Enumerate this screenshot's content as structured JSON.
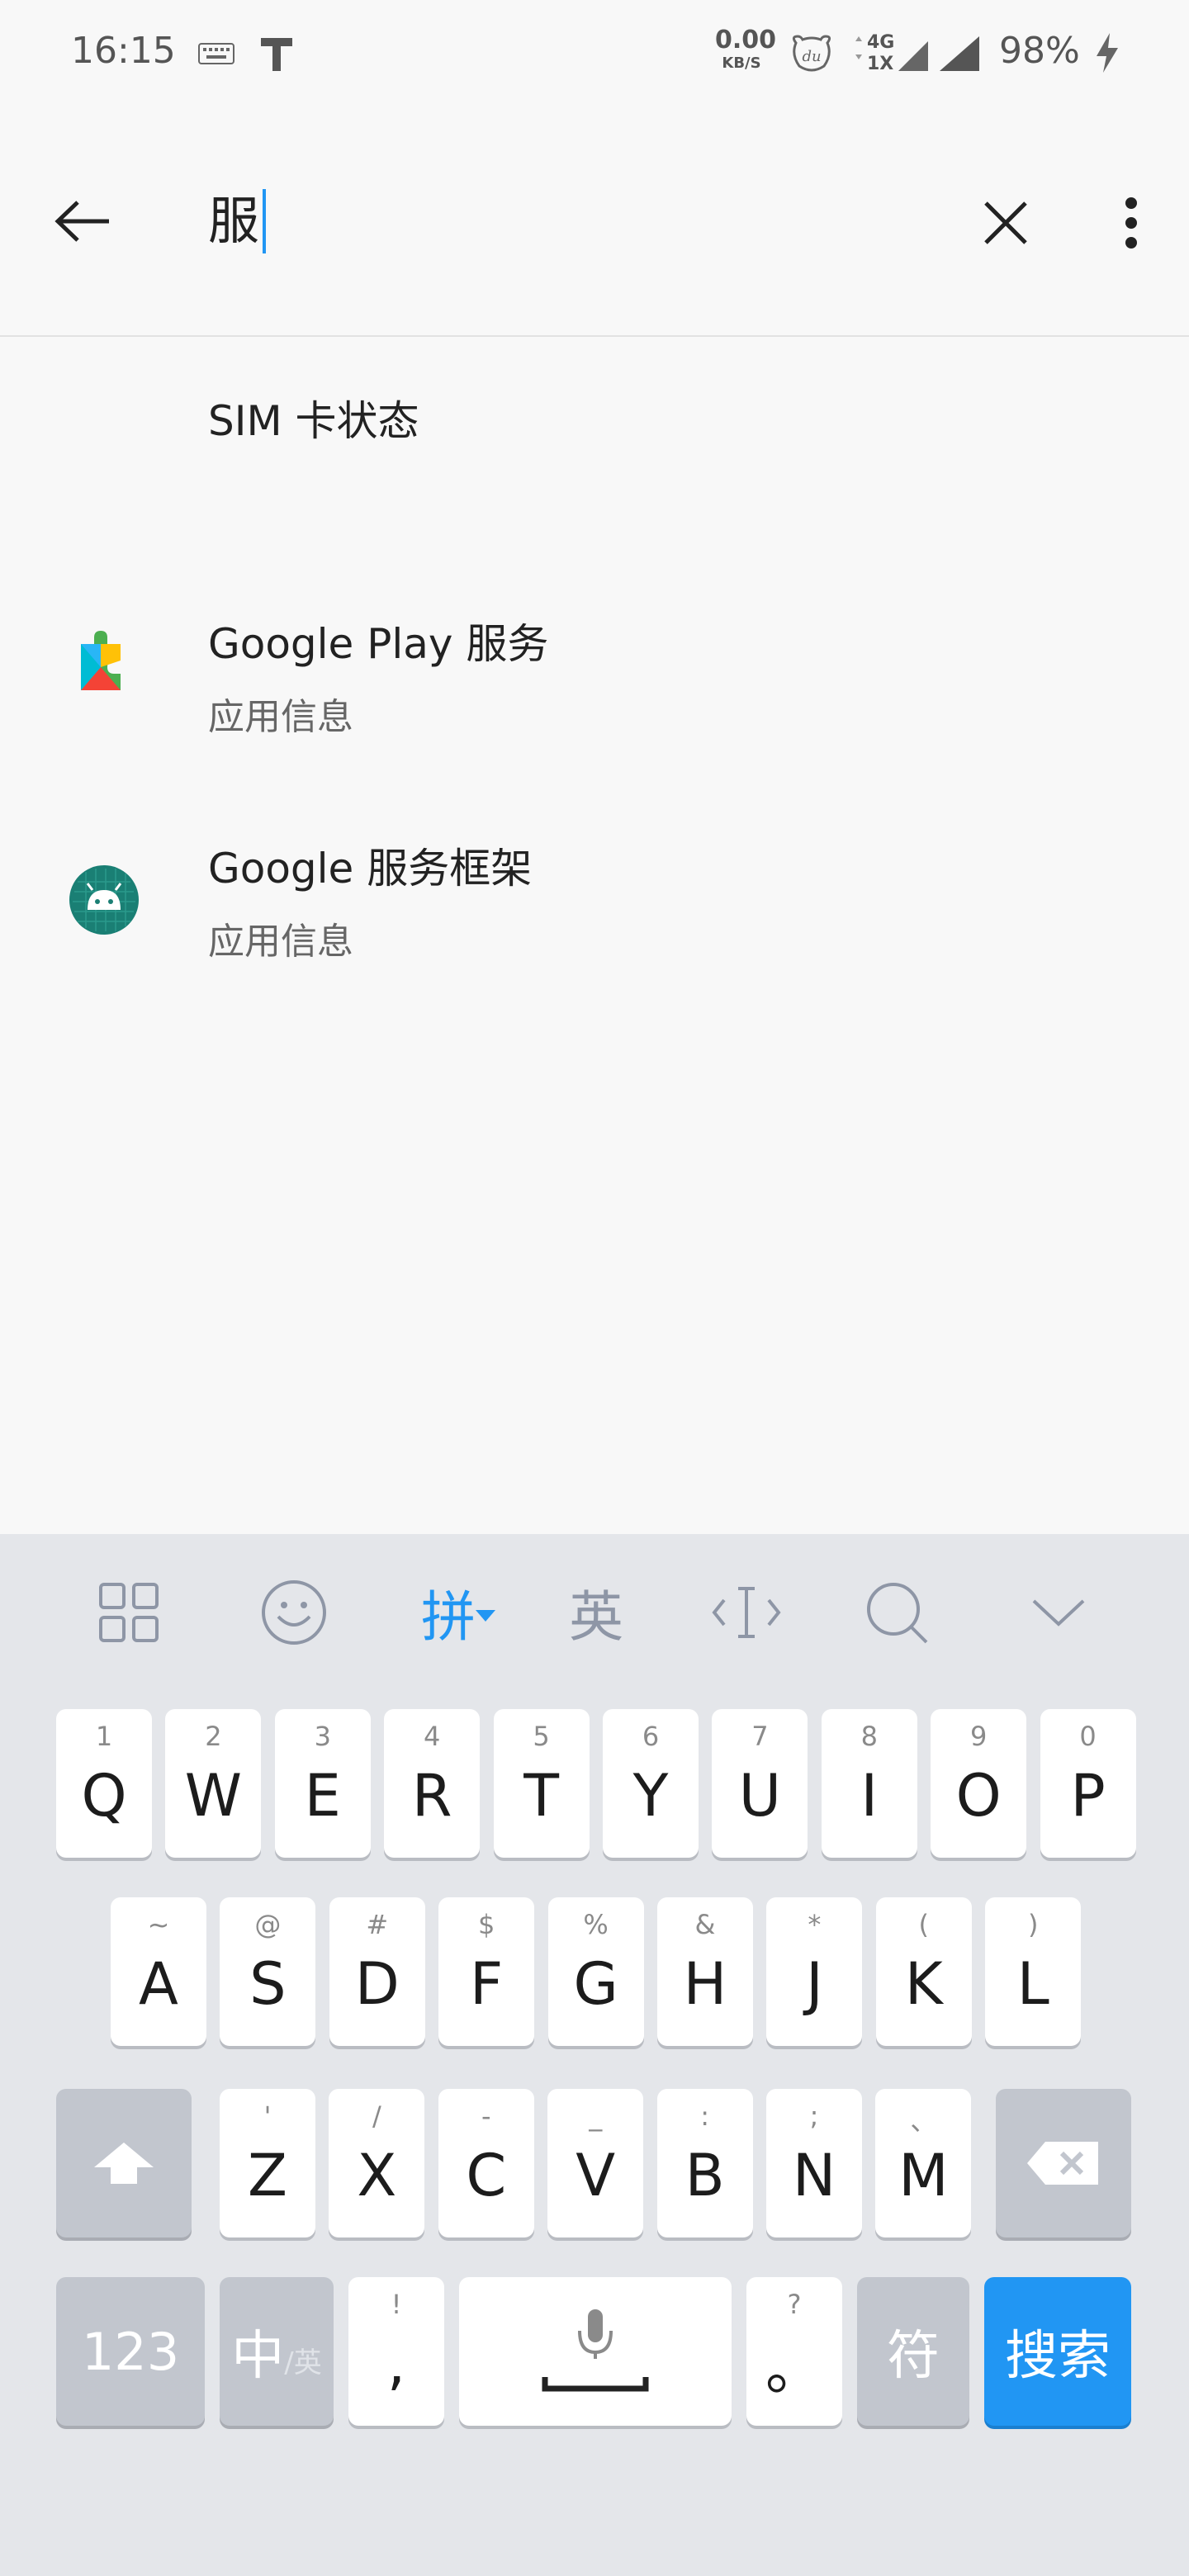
{
  "status_bar": {
    "time": "16:15",
    "net_speed_value": "0.00",
    "net_speed_unit": "KB/S",
    "network_type_top": "4G",
    "network_type_bottom": "1X",
    "battery": "98%",
    "icons": [
      "keyboard-icon",
      "t-icon",
      "du-app-icon",
      "signal-icon",
      "charging-icon"
    ]
  },
  "search": {
    "query": "服",
    "back_icon": "arrow-left-icon",
    "clear_icon": "close-icon",
    "more_icon": "more-vert-icon",
    "caret_color": "#2196f3"
  },
  "results": [
    {
      "title": "SIM 卡状态",
      "subtitle": ""
    },
    {
      "title": "Google Play 服务",
      "subtitle": "应用信息",
      "icon": "google-play-services-icon"
    },
    {
      "title": "Google 服务框架",
      "subtitle": "应用信息",
      "icon": "android-icon"
    }
  ],
  "keyboard": {
    "toolbar": {
      "grid_icon": "grid-icon",
      "emoji_icon": "emoji-icon",
      "pinyin_label": "拼",
      "english_label": "英",
      "cursor_icon": "cursor-move-icon",
      "search_icon": "search-icon",
      "collapse_icon": "chevron-down-icon"
    },
    "row1": [
      {
        "key": "Q",
        "hint": "1"
      },
      {
        "key": "W",
        "hint": "2"
      },
      {
        "key": "E",
        "hint": "3"
      },
      {
        "key": "R",
        "hint": "4"
      },
      {
        "key": "T",
        "hint": "5"
      },
      {
        "key": "Y",
        "hint": "6"
      },
      {
        "key": "U",
        "hint": "7"
      },
      {
        "key": "I",
        "hint": "8"
      },
      {
        "key": "O",
        "hint": "9"
      },
      {
        "key": "P",
        "hint": "0"
      }
    ],
    "row2": [
      {
        "key": "A",
        "hint": "~"
      },
      {
        "key": "S",
        "hint": "@"
      },
      {
        "key": "D",
        "hint": "#"
      },
      {
        "key": "F",
        "hint": "$"
      },
      {
        "key": "G",
        "hint": "%"
      },
      {
        "key": "H",
        "hint": "&"
      },
      {
        "key": "J",
        "hint": "*"
      },
      {
        "key": "K",
        "hint": "("
      },
      {
        "key": "L",
        "hint": ")"
      }
    ],
    "row3": [
      {
        "key": "Z",
        "hint": "'"
      },
      {
        "key": "X",
        "hint": "/"
      },
      {
        "key": "C",
        "hint": "-"
      },
      {
        "key": "V",
        "hint": "_"
      },
      {
        "key": "B",
        "hint": ":"
      },
      {
        "key": "N",
        "hint": ";"
      },
      {
        "key": "M",
        "hint": "、"
      }
    ],
    "shift_icon": "shift-icon",
    "backspace_icon": "backspace-icon",
    "numbers_label": "123",
    "lang_main": "中",
    "lang_sub": "/英",
    "comma_key": ",",
    "comma_hint": "!",
    "space_icon": "microphone-icon",
    "period_key": "。",
    "period_hint": "?",
    "symbols_label": "符",
    "search_key": "搜索",
    "accent_color": "#2196f3"
  }
}
